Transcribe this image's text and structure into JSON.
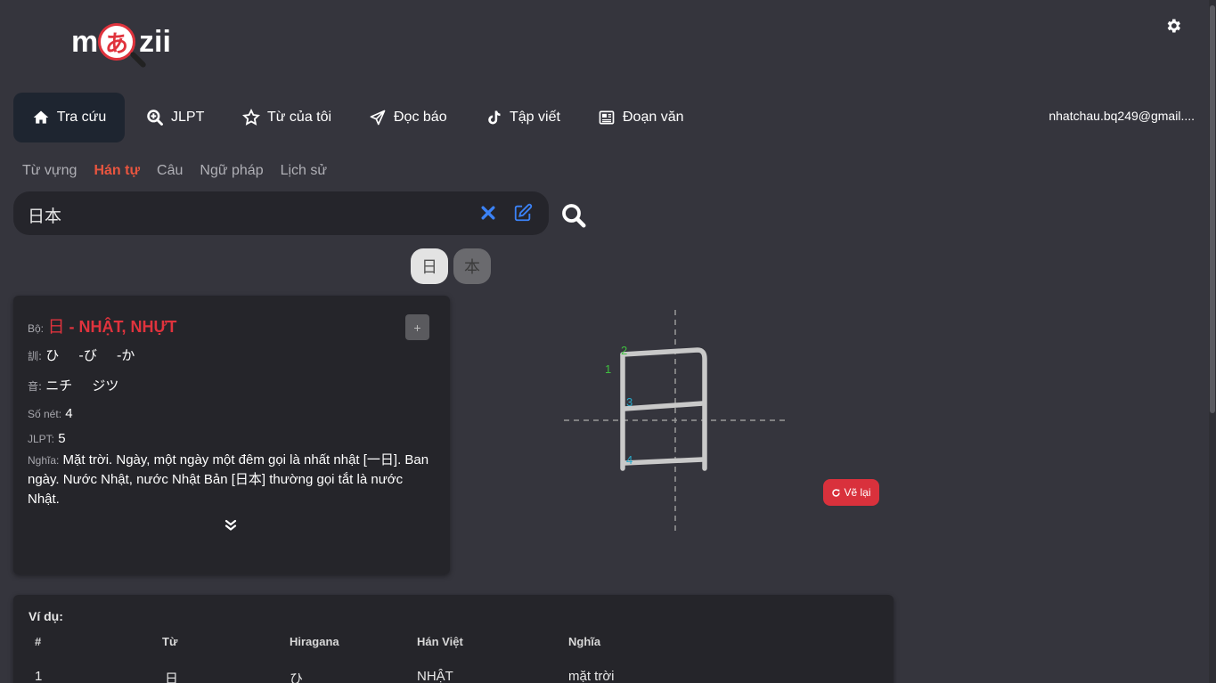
{
  "brand": {
    "left": "m",
    "circle": "あ",
    "right": "zii"
  },
  "nav": {
    "items": [
      {
        "label": "Tra cứu",
        "icon": "home-icon"
      },
      {
        "label": "JLPT",
        "icon": "zoom-in-icon"
      },
      {
        "label": "Từ của tôi",
        "icon": "star-icon"
      },
      {
        "label": "Đọc báo",
        "icon": "send-icon"
      },
      {
        "label": "Tập viết",
        "icon": "tiktok-icon"
      },
      {
        "label": "Đoạn văn",
        "icon": "newspaper-icon"
      }
    ],
    "user": "nhatchau.bq249@gmail...."
  },
  "subtabs": [
    "Từ vựng",
    "Hán tự",
    "Câu",
    "Ngữ pháp",
    "Lịch sử"
  ],
  "search": {
    "value": "日本"
  },
  "chars": [
    "日",
    "本"
  ],
  "kanji_card": {
    "radical_label": "Bộ:",
    "radical_kanji": "日",
    "radical_hv": " - NHẬT, NHỰT",
    "plus": "+",
    "kun_label": "訓:",
    "kun_values": [
      "ひ",
      "-び",
      "-か"
    ],
    "on_label": "音:",
    "on_values": [
      "ニチ",
      "ジツ"
    ],
    "strokes_label": "Số nét:",
    "strokes": "4",
    "jlpt_label": "JLPT:",
    "jlpt": "5",
    "meaning_label": "Nghĩa:",
    "meaning": "Mặt trời. Ngày, một ngày một đêm gọi là nhất nhật [一日]. Ban ngày. Nước Nhật, nước Nhật Bản [日本] thường gọi tắt là nước Nhật."
  },
  "stroke_numbers": [
    "1",
    "2",
    "3",
    "4"
  ],
  "redraw_label": "Vẽ lại",
  "examples": {
    "title": "Ví dụ:",
    "headers": [
      "#",
      "Từ",
      "Hiragana",
      "Hán Việt",
      "Nghĩa"
    ],
    "rows": [
      [
        "1",
        "日",
        "ひ",
        "NHẬT",
        "mặt trời"
      ]
    ]
  },
  "colors": {
    "accent_red": "#e0333d",
    "active_tab": "#e8553f",
    "icon_blue": "#3b82f6"
  }
}
